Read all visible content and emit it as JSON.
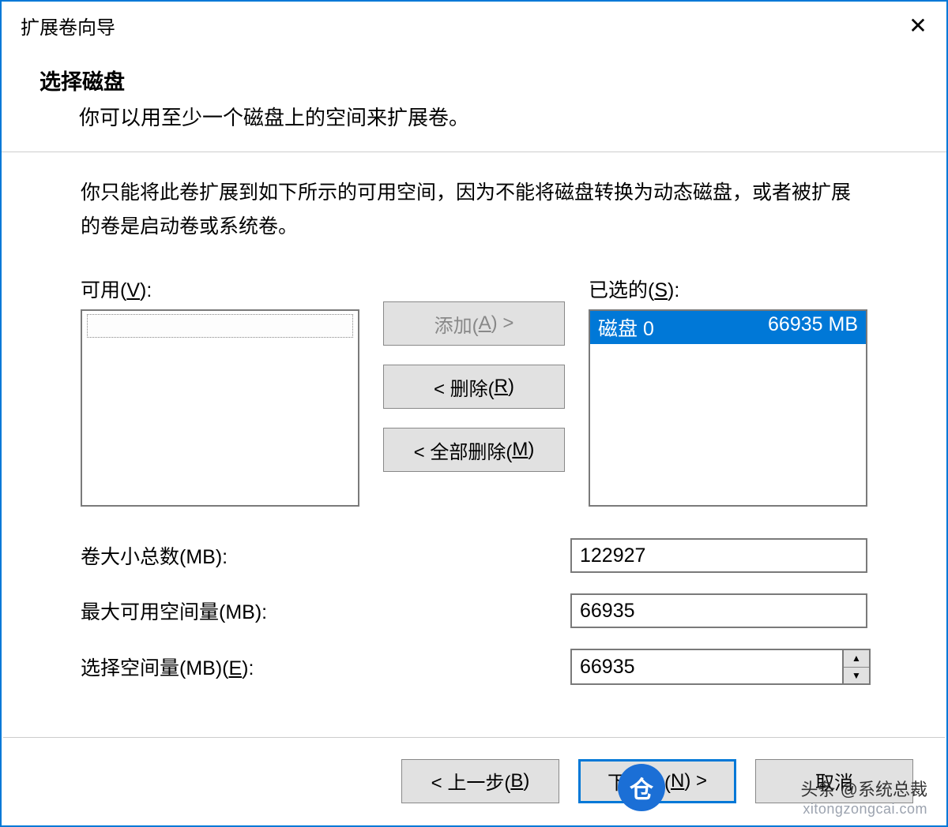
{
  "window": {
    "title": "扩展卷向导"
  },
  "header": {
    "title": "选择磁盘",
    "subtitle": "你可以用至少一个磁盘上的空间来扩展卷。"
  },
  "body": {
    "info": "你只能将此卷扩展到如下所示的可用空间，因为不能将磁盘转换为动态磁盘，或者被扩展的卷是启动卷或系统卷。",
    "available_label_pre": "可用(",
    "available_label_u": "V",
    "available_label_post": "):",
    "selected_label_pre": "已选的(",
    "selected_label_u": "S",
    "selected_label_post": "):",
    "selected_item_name": "磁盘 0",
    "selected_item_size": "66935 MB",
    "btn_add_pre": "添加(",
    "btn_add_u": "A",
    "btn_add_post": ") >",
    "btn_remove_pre": "< 删除(",
    "btn_remove_u": "R",
    "btn_remove_post": ")",
    "btn_remove_all_pre": "< 全部删除(",
    "btn_remove_all_u": "M",
    "btn_remove_all_post": ")"
  },
  "fields": {
    "total_label": "卷大小总数(MB):",
    "total_value": "122927",
    "max_label": "最大可用空间量(MB):",
    "max_value": "66935",
    "select_label_pre": "选择空间量(MB)(",
    "select_label_u": "E",
    "select_label_post": "):",
    "select_value": "66935"
  },
  "footer": {
    "back_pre": "< 上一步(",
    "back_u": "B",
    "back_post": ")",
    "next_pre": "下一步(",
    "next_u": "N",
    "next_post": ") >",
    "cancel": "取消"
  },
  "watermark": {
    "line1": "头条 @系统总裁",
    "line2": "xitongzongcai.com",
    "badge": "仓"
  }
}
